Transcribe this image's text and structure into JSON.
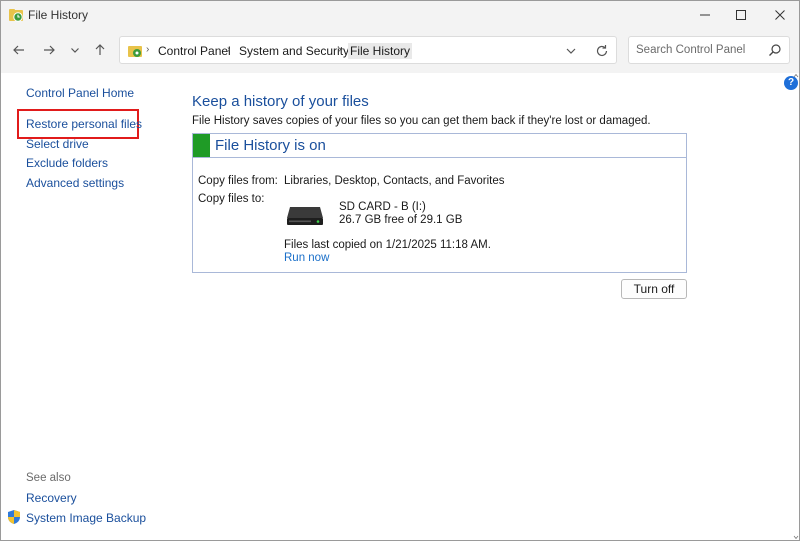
{
  "window": {
    "title": "File History"
  },
  "address": {
    "crumbs": [
      "Control Panel",
      "System and Security",
      "File History"
    ],
    "search_placeholder": "Search Control Panel"
  },
  "sidebar": {
    "home": "Control Panel Home",
    "items": [
      {
        "label": "Restore personal files"
      },
      {
        "label": "Select drive"
      },
      {
        "label": "Exclude folders"
      },
      {
        "label": "Advanced settings"
      }
    ],
    "see_also_label": "See also",
    "see_also": [
      {
        "label": "Recovery"
      },
      {
        "label": "System Image Backup"
      }
    ]
  },
  "main": {
    "heading": "Keep a history of your files",
    "description": "File History saves copies of your files so you can get them back if they're lost or damaged.",
    "status_title": "File History is on",
    "copy_from_label": "Copy files from:",
    "copy_from_value": "Libraries, Desktop, Contacts, and Favorites",
    "copy_to_label": "Copy files to:",
    "drive_name": "SD CARD - B (I:)",
    "drive_space": "26.7 GB free of 29.1 GB",
    "last_copied": "Files last copied on 1/21/2025 11:18 AM.",
    "run_now": "Run now",
    "turn_off": "Turn off"
  },
  "colors": {
    "link": "#1a4f9c",
    "status_on": "#1f9b26",
    "highlight": "#e11b1b"
  },
  "help": "?"
}
